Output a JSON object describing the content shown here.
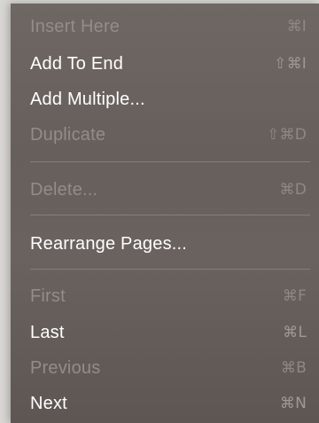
{
  "menu": {
    "items": [
      {
        "label": "Insert Here",
        "shortcut": "⌘I",
        "enabled": false
      },
      {
        "label": "Add To End",
        "shortcut": "⇧⌘I",
        "enabled": true
      },
      {
        "label": "Add Multiple...",
        "shortcut": "",
        "enabled": true
      },
      {
        "label": "Duplicate",
        "shortcut": "⇧⌘D",
        "enabled": false
      },
      {
        "label": "Delete...",
        "shortcut": "⌘D",
        "enabled": false
      },
      {
        "label": "Rearrange Pages...",
        "shortcut": "",
        "enabled": true
      },
      {
        "label": "First",
        "shortcut": "⌘F",
        "enabled": false
      },
      {
        "label": "Last",
        "shortcut": "⌘L",
        "enabled": true
      },
      {
        "label": "Previous",
        "shortcut": "⌘B",
        "enabled": false
      },
      {
        "label": "Next",
        "shortcut": "⌘N",
        "enabled": true
      }
    ]
  },
  "colors": {
    "menu_background": "#675f5b",
    "enabled_text": "#ffffff",
    "disabled_text": "#938c88",
    "separator": "#867e7a"
  }
}
